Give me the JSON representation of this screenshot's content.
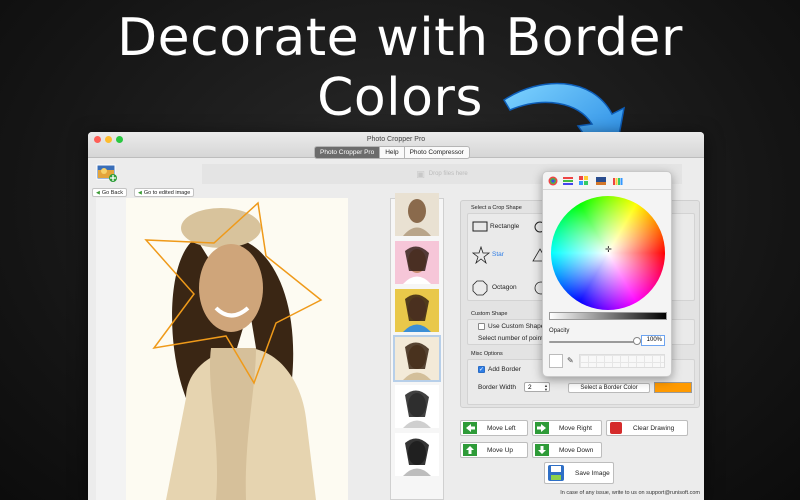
{
  "headline": {
    "line1": "Decorate with Border",
    "line2": "Colors"
  },
  "window": {
    "title": "Photo Cropper Pro",
    "tabs": [
      {
        "label": "Photo Cropper Pro",
        "active": true
      },
      {
        "label": "Help",
        "active": false
      },
      {
        "label": "Photo Compressor",
        "active": false
      }
    ],
    "drop_text": "Drop files here",
    "go_back": "Go Back",
    "go_edited": "Go to edited image"
  },
  "crop_shape": {
    "label": "Select a Crop Shape",
    "shapes": [
      {
        "label": "Rectangle"
      },
      {
        "label": "Star",
        "selected": true
      },
      {
        "label": "Octagon"
      }
    ]
  },
  "custom_shape": {
    "label": "Custom Shape",
    "use_custom": "Use Custom Shape",
    "points_label": "Select number of point"
  },
  "misc": {
    "label": "Misc Options",
    "add_border": "Add Border",
    "add_border_checked": true,
    "border_width_label": "Border Width",
    "border_width_value": "2",
    "select_color": "Select a Border Color",
    "border_color": "#ff9a00"
  },
  "actions": {
    "move_left": "Move Left",
    "move_right": "Move Right",
    "clear": "Clear Drawing",
    "move_up": "Move Up",
    "move_down": "Move Down",
    "save": "Save Image"
  },
  "footer": "In case of any issue, write to us on support@runisoft.com",
  "color_picker": {
    "opacity_label": "Opacity",
    "opacity_value": "100%"
  }
}
